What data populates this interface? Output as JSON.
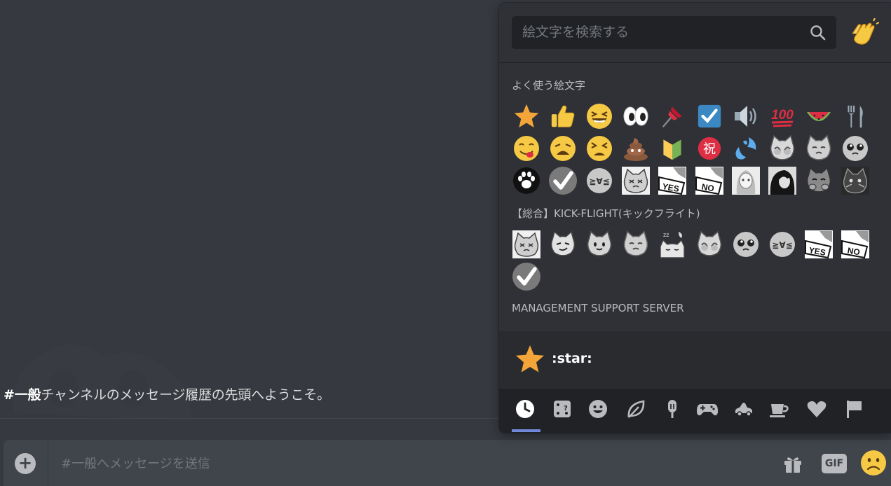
{
  "chat": {
    "welcome_channel": "#一般",
    "welcome_text": "チャンネルのメッセージ履歴の先頭へようこそ。"
  },
  "composer": {
    "placeholder": "#一般へメッセージを送信",
    "gif_label": "GIF",
    "add_icon": "plus-circle-icon",
    "gift_icon": "gift-icon",
    "emoji_icon": "slightly-frowning-face-icon"
  },
  "picker": {
    "search_placeholder": "絵文字を検索する",
    "search_icon": "magnifier-icon",
    "skin_tone_icon": "clapping-hands-icon",
    "categories": [
      {
        "label": "よく使う絵文字",
        "emojis": [
          "star",
          "thumbsup",
          "laughing",
          "eyes",
          "pushpin",
          "ballot-box-check",
          "loud-sound",
          "100",
          "watermelon",
          "fork-and-knife",
          "yum",
          "weary",
          "tired-face",
          "poop",
          "beginner",
          "congratulations-ideograph",
          "sweat-drops",
          "custom-cat-hiding-face",
          "custom-cat-sad",
          "custom-face-pleading",
          "custom-paw",
          "custom-check-gray",
          "custom-face-geq",
          "custom-cat-sketch",
          "custom-yes-sign",
          "custom-no-sign",
          "custom-girl-sketch",
          "custom-portrait-dark",
          "custom-cat-hands",
          "custom-cat-dark"
        ]
      },
      {
        "label": "【総合】KICK-FLIGHT(キックフライト)",
        "emojis": [
          "custom-cat-sketch",
          "custom-cat-smirk",
          "custom-cat-smile",
          "custom-cat-sad",
          "custom-cat-sleep",
          "custom-cat-hiding-face",
          "custom-face-pleading",
          "custom-face-geq",
          "custom-yes-sign",
          "custom-no-sign",
          "custom-check-gray"
        ]
      },
      {
        "label": "MANAGEMENT SUPPORT SERVER",
        "emojis": []
      }
    ],
    "preview": {
      "emoji": "star",
      "name": ":star:"
    },
    "nav": [
      {
        "name": "recent",
        "icon": "clock-icon",
        "active": true
      },
      {
        "name": "custom",
        "icon": "dice-icon",
        "active": false
      },
      {
        "name": "people",
        "icon": "smiley-icon",
        "active": false
      },
      {
        "name": "nature",
        "icon": "leaf-icon",
        "active": false
      },
      {
        "name": "food",
        "icon": "popsicle-icon",
        "active": false
      },
      {
        "name": "activities",
        "icon": "gamepad-icon",
        "active": false
      },
      {
        "name": "travel",
        "icon": "car-icon",
        "active": false
      },
      {
        "name": "objects",
        "icon": "cup-icon",
        "active": false
      },
      {
        "name": "symbols",
        "icon": "heart-icon",
        "active": false
      },
      {
        "name": "flags",
        "icon": "flag-icon",
        "active": false
      }
    ]
  },
  "colors": {
    "background": "#36393f",
    "picker_background": "#2f3136",
    "nav_background": "#202225",
    "accent": "#7289da",
    "star": "#f4a53a"
  }
}
